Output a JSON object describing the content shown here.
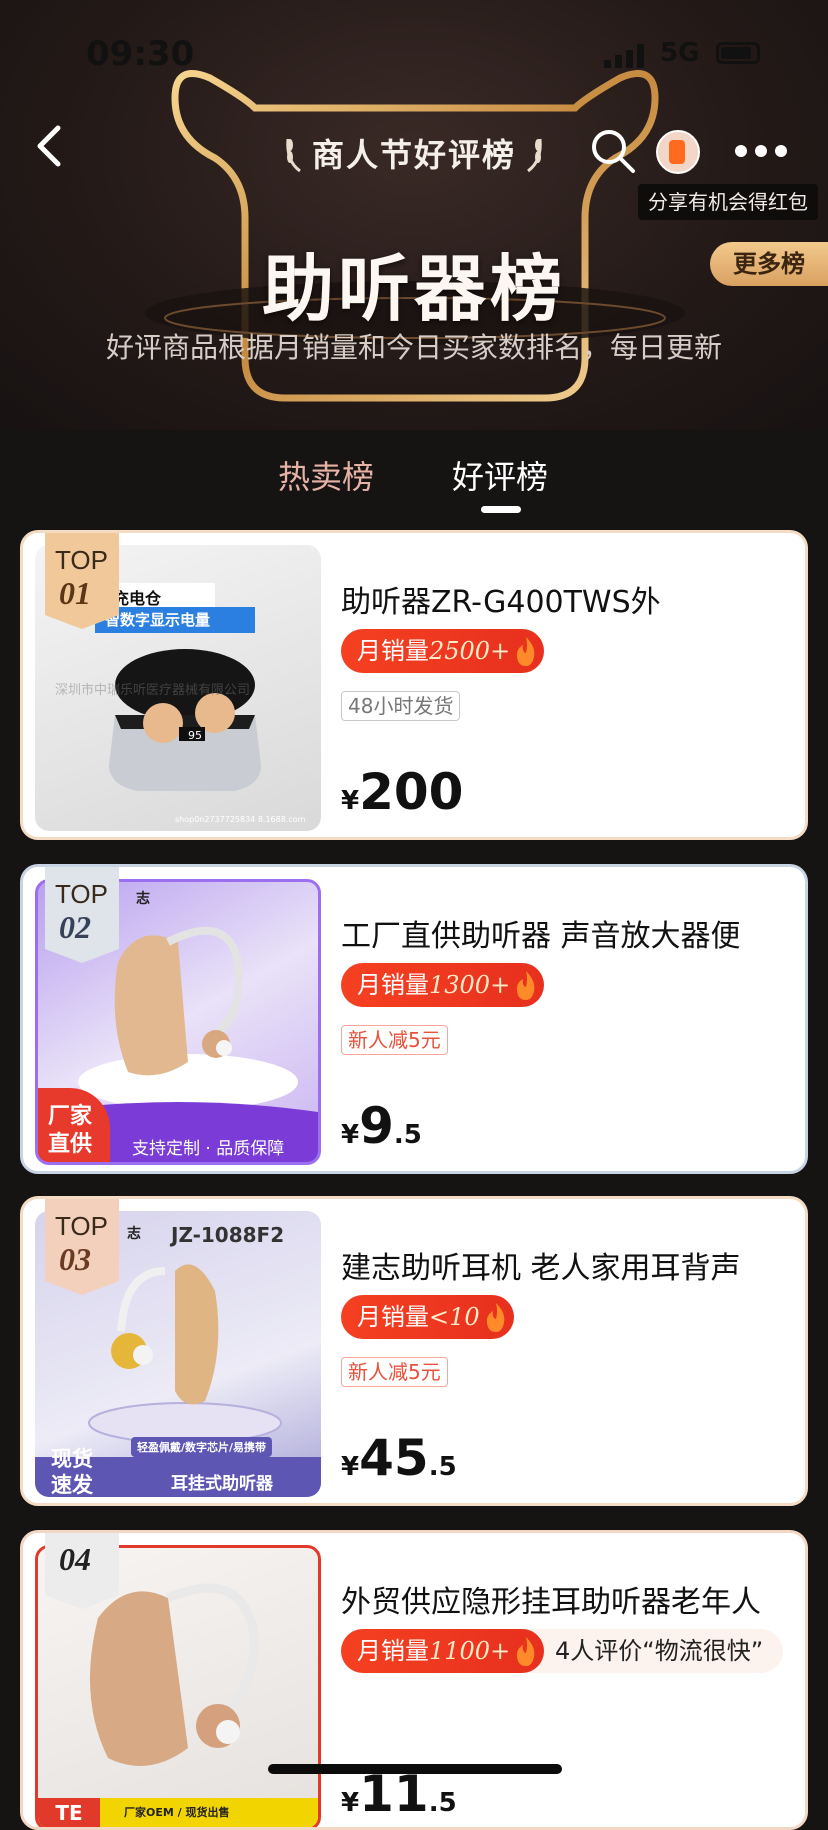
{
  "status_bar": {
    "time": "09:30",
    "network": "5G"
  },
  "header": {
    "title": "商人节好评榜",
    "share_tip": "分享有机会得红包",
    "more_rankings": "更多榜",
    "big_title": "助听器榜",
    "subtitle": "好评商品根据月销量和今日买家数排名，每日更新"
  },
  "tabs": [
    {
      "label": "热卖榜"
    },
    {
      "label": "好评榜"
    }
  ],
  "products": [
    {
      "rank_top": "TOP",
      "rank_no": "01",
      "name": "助听器ZR-G400TWS外",
      "sales_label": "月销量",
      "sales_value": "2500+",
      "tag": "48小时发货",
      "price_yen": "¥",
      "price_int": "200",
      "price_dec": "",
      "thumb_text": {
        "badge": "充电仓",
        "sub": "智数字显示电量",
        "watermark": "深圳市中瑞乐听医疗器械有限公司",
        "footer": "shop0n2737725834 8.1688.com",
        "display": "95"
      }
    },
    {
      "rank_top": "TOP",
      "rank_no": "02",
      "name": "工厂直供助听器 声音放大器便",
      "sales_label": "月销量",
      "sales_value": "1300+",
      "tag": "新人减5元",
      "price_yen": "¥",
      "price_int": "9",
      "price_dec": ".5",
      "thumb_text": {
        "corner": "志",
        "badge1": "厂家",
        "badge2": "直供",
        "footer": "支持定制 · 品质保障"
      }
    },
    {
      "rank_top": "TOP",
      "rank_no": "03",
      "name": "建志助听耳机 老人家用耳背声",
      "sales_label": "月销量",
      "sales_value": "<10",
      "tag": "新人减5元",
      "price_yen": "¥",
      "price_int": "45",
      "price_dec": ".5",
      "thumb_text": {
        "corner": "志",
        "model": "JZ-1088F2",
        "strip": "轻盈佩戴/数字芯片/易携带",
        "badge1": "现货",
        "badge2": "速发",
        "footer": "耳挂式助听器"
      }
    },
    {
      "rank_top": "",
      "rank_no": "04",
      "name": "外贸供应隐形挂耳助听器老年人",
      "sales_label": "月销量",
      "sales_value": "1100+",
      "review": "4人评价“物流很快”",
      "price_yen": "¥",
      "price_int": "11",
      "price_dec": ".5",
      "thumb_text": {
        "strip": "厂家OEM / 现货出售",
        "badge1": "TE"
      }
    }
  ],
  "colors": {
    "accent_red": "#e8391f",
    "gold": "#d9a161",
    "bg_dark": "#161313"
  }
}
